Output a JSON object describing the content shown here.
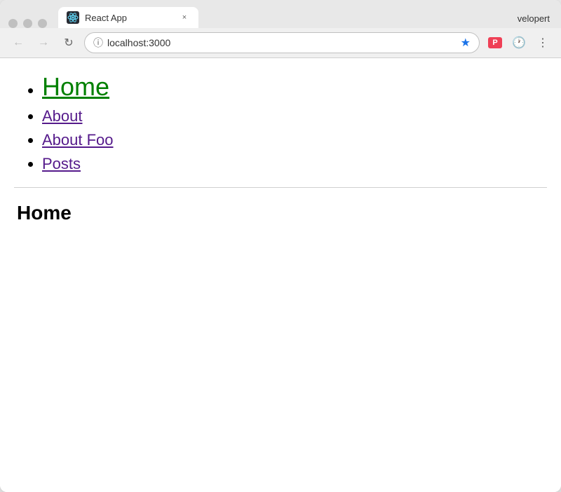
{
  "browser": {
    "tab": {
      "title": "React App",
      "favicon_label": "react-favicon"
    },
    "close_label": "×",
    "profile_name": "velopert",
    "address_bar": {
      "url": "localhost:3000",
      "placeholder": "localhost:3000"
    }
  },
  "nav": {
    "links": [
      {
        "label": "Home",
        "active": true,
        "visited": false
      },
      {
        "label": "About",
        "active": false,
        "visited": true
      },
      {
        "label": "About Foo",
        "active": false,
        "visited": true
      },
      {
        "label": "Posts",
        "active": false,
        "visited": true
      }
    ]
  },
  "page": {
    "heading": "Home"
  }
}
